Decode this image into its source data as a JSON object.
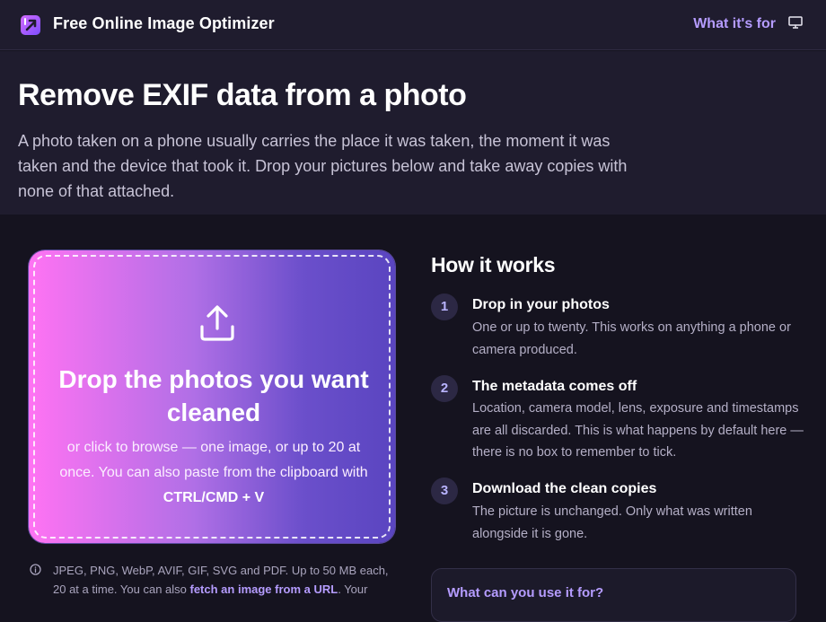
{
  "header": {
    "brand": "Free Online Image Optimizer",
    "nav_link": "What it's for",
    "logo_icon": "optimizer-logo-icon",
    "monitor_icon": "monitor-icon",
    "accent": "#b59cff"
  },
  "hero": {
    "title": "Remove EXIF data from a photo",
    "description": "A photo taken on a phone usually carries the place it was taken, the moment it was taken and the device that took it. Drop your pictures below and take away copies with none of that attached."
  },
  "dropzone": {
    "icon": "upload-icon",
    "title": "Drop the photos you want cleaned",
    "subtitle_prefix": "or click to browse — one image, or up to 20 at once. You can also paste from the clipboard with ",
    "shortcut": "CTRL/CMD + V",
    "gradient": [
      "#ff73f3",
      "#5a45c0"
    ]
  },
  "formats": {
    "text_prefix": "JPEG, PNG, WebP, AVIF, GIF, SVG and PDF. Up to 50 MB each, 20 at a time. You can also ",
    "link_text": "fetch an image from a URL",
    "text_suffix": ". Your"
  },
  "how_it_works": {
    "title": "How it works",
    "steps": [
      {
        "number": "1",
        "title": "Drop in your photos",
        "description": "One or up to twenty. This works on anything a phone or camera produced."
      },
      {
        "number": "2",
        "title": "The metadata comes off",
        "description": "Location, camera model, lens, exposure and timestamps are all discarded. This is what happens by default here — there is no box to remember to tick."
      },
      {
        "number": "3",
        "title": "Download the clean copies",
        "description": "The picture is unchanged. Only what was written alongside it is gone."
      }
    ]
  },
  "faq": {
    "title": "What can you use it for?"
  }
}
